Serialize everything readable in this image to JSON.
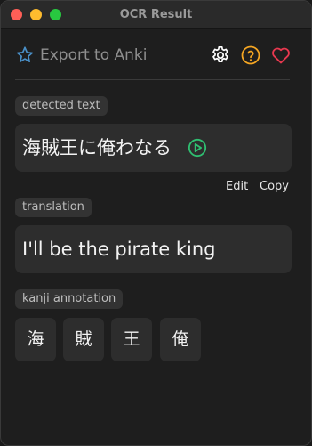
{
  "window": {
    "title": "OCR Result"
  },
  "toolbar": {
    "export_label": "Export to Anki",
    "icons": [
      "anki-star-icon",
      "gear-icon",
      "help-icon",
      "heart-icon"
    ]
  },
  "detected": {
    "label": "detected text",
    "text": "海賊王に俺わなる",
    "actions": {
      "edit": "Edit",
      "copy": "Copy"
    }
  },
  "translation": {
    "label": "translation",
    "text": "I'll be the pirate king"
  },
  "kanji": {
    "label": "kanji annotation",
    "items": [
      "海",
      "賊",
      "王",
      "俺"
    ]
  },
  "colors": {
    "background": "#1e1e1e",
    "card": "#2d2d2d",
    "accent_blue": "#4a90c8",
    "accent_orange": "#f5a623",
    "accent_red": "#e8384f",
    "accent_green": "#2fbf71"
  }
}
